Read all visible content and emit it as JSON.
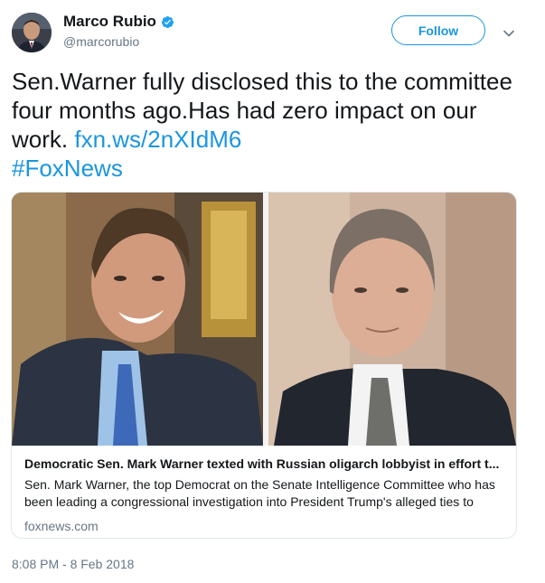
{
  "author": {
    "name": "Marco Rubio",
    "handle": "@marcorubio"
  },
  "follow_label": "Follow",
  "tweet": {
    "text": "Sen.Warner fully disclosed this to the committee four months ago.Has had zero impact on our work.",
    "link": "fxn.ws/2nXIdM6",
    "hashtag": "#FoxNews"
  },
  "card": {
    "title": "Democratic Sen. Mark Warner texted with Russian oligarch lobbyist in effort t...",
    "description": "Sen. Mark Warner, the top Democrat on the Senate Intelligence Committee who has been leading a congressional investigation into President Trump's alleged ties to",
    "domain": "foxnews.com"
  },
  "timestamp": "8:08 PM - 8 Feb 2018",
  "colors": {
    "accent": "#1b95e0",
    "secondary_text": "#657786",
    "border": "#e1e8ed"
  },
  "icons": {
    "verified": "verified-badge-icon",
    "more": "chevron-down-icon"
  }
}
